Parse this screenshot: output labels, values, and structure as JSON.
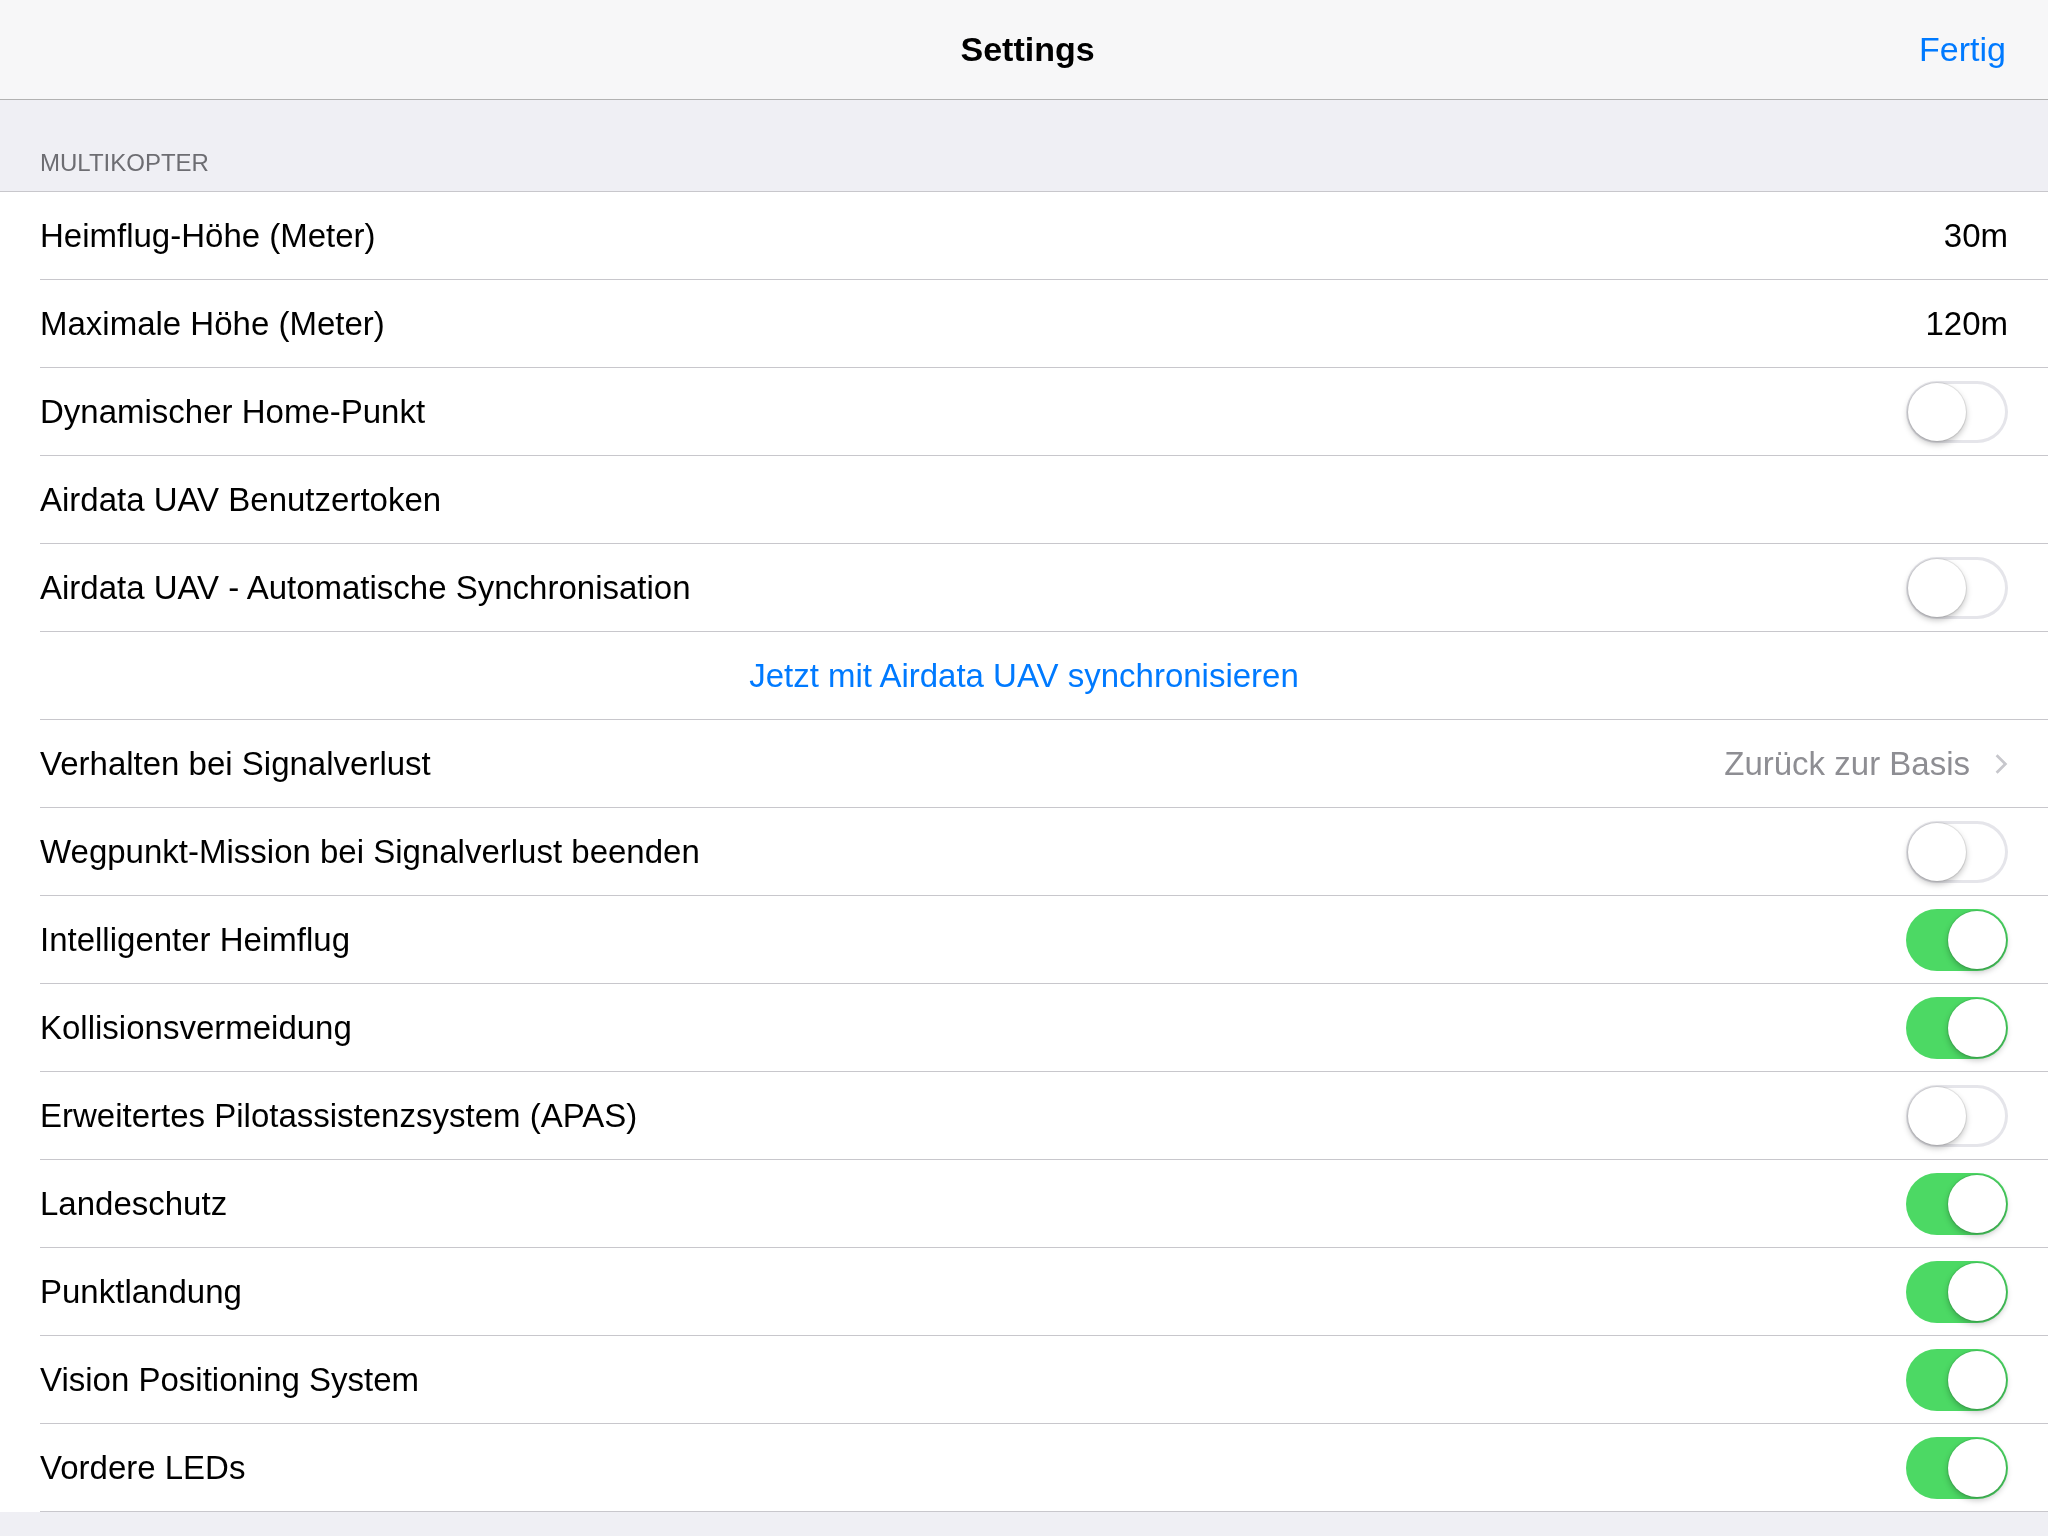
{
  "nav": {
    "title": "Settings",
    "done": "Fertig"
  },
  "section": {
    "header": "MULTIKOPTER",
    "rows": [
      {
        "kind": "value",
        "label": "Heimflug-Höhe (Meter)",
        "value": "30m"
      },
      {
        "kind": "value",
        "label": "Maximale Höhe (Meter)",
        "value": "120m"
      },
      {
        "kind": "toggle",
        "label": "Dynamischer Home-Punkt",
        "on": false
      },
      {
        "kind": "plain",
        "label": "Airdata UAV Benutzertoken"
      },
      {
        "kind": "toggle",
        "label": "Airdata UAV - Automatische Synchronisation",
        "on": false
      },
      {
        "kind": "action",
        "label": "Jetzt mit Airdata UAV synchronisieren"
      },
      {
        "kind": "disclosure",
        "label": "Verhalten bei Signalverlust",
        "value": "Zurück zur Basis"
      },
      {
        "kind": "toggle",
        "label": "Wegpunkt-Mission bei Signalverlust beenden",
        "on": false
      },
      {
        "kind": "toggle",
        "label": "Intelligenter Heimflug",
        "on": true
      },
      {
        "kind": "toggle",
        "label": "Kollisionsvermeidung",
        "on": true
      },
      {
        "kind": "toggle",
        "label": "Erweitertes Pilotassistenzsystem (APAS)",
        "on": false
      },
      {
        "kind": "toggle",
        "label": "Landeschutz",
        "on": true
      },
      {
        "kind": "toggle",
        "label": "Punktlandung",
        "on": true
      },
      {
        "kind": "toggle",
        "label": "Vision Positioning System",
        "on": true
      },
      {
        "kind": "toggle",
        "label": "Vordere LEDs",
        "on": true
      }
    ]
  }
}
